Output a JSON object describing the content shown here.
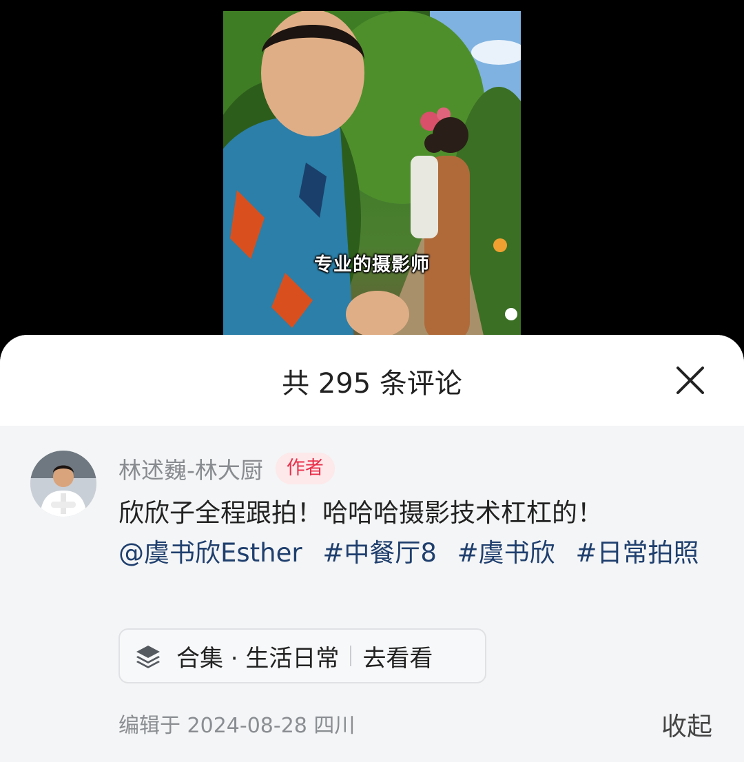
{
  "video": {
    "subtitle": "专业的摄影师"
  },
  "sheet": {
    "title": "共 295 条评论",
    "close_icon": "close-icon"
  },
  "post": {
    "author": "林述巍-林大厨",
    "author_badge": "作者",
    "text": "欣欣子全程跟拍！哈哈哈摄影技术杠杠的！",
    "mention": "@虞书欣Esther",
    "hashtags": [
      "#中餐厅8",
      "#虞书欣",
      "#日常拍照"
    ],
    "collection": {
      "icon": "layers-icon",
      "label": "合集 · 生活日常",
      "action": "去看看"
    },
    "meta": "编辑于 2024-08-28 四川",
    "collapse_label": "收起"
  },
  "colors": {
    "badge_text": "#e8304a",
    "badge_bg": "#fde8ea",
    "tag_text": "#1f3f6e",
    "sheet_bg": "#f4f5f6"
  }
}
